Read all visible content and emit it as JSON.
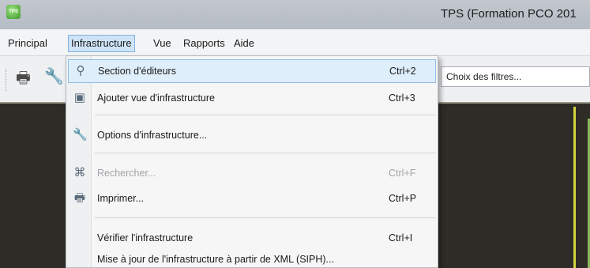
{
  "window": {
    "app_badge": "TPS",
    "title": "TPS (Formation PCO 201"
  },
  "menubar": {
    "items": [
      "Principal",
      "Infrastructure",
      "Vue",
      "Rapports",
      "Aide"
    ],
    "open_menu": "Infrastructure"
  },
  "toolbar": {
    "icons": [
      "printer-icon",
      "wrench-icon"
    ],
    "filter_placeholder": "Choix des filtres..."
  },
  "dropdown": {
    "items": [
      {
        "icon": "network-icon",
        "label": "Section d'éditeurs",
        "shortcut": "Ctrl+2",
        "highlighted": true,
        "enabled": true
      },
      {
        "icon": "add-view-icon",
        "label": "Ajouter vue d'infrastructure",
        "shortcut": "Ctrl+3",
        "highlighted": false,
        "enabled": true
      },
      {
        "icon": "wrench-icon",
        "label": "Options d'infrastructure...",
        "shortcut": "",
        "highlighted": false,
        "enabled": true
      },
      {
        "icon": "binoculars-icon",
        "label": "Rechercher...",
        "shortcut": "Ctrl+F",
        "highlighted": false,
        "enabled": false
      },
      {
        "icon": "printer-icon",
        "label": "Imprimer...",
        "shortcut": "Ctrl+P",
        "highlighted": false,
        "enabled": true
      },
      {
        "icon": "",
        "label": "Vérifier l'infrastructure",
        "shortcut": "Ctrl+I",
        "highlighted": false,
        "enabled": true
      },
      {
        "icon": "",
        "label": "Mise à jour de l'infrastructure à partir de XML (SIPH)...",
        "shortcut": "",
        "highlighted": false,
        "enabled": true
      }
    ]
  },
  "colors": {
    "highlight": "#deeefb",
    "highlight_border": "#8fbde8",
    "workspace": "#2e2c26",
    "accent_line": "#d2d43e"
  }
}
